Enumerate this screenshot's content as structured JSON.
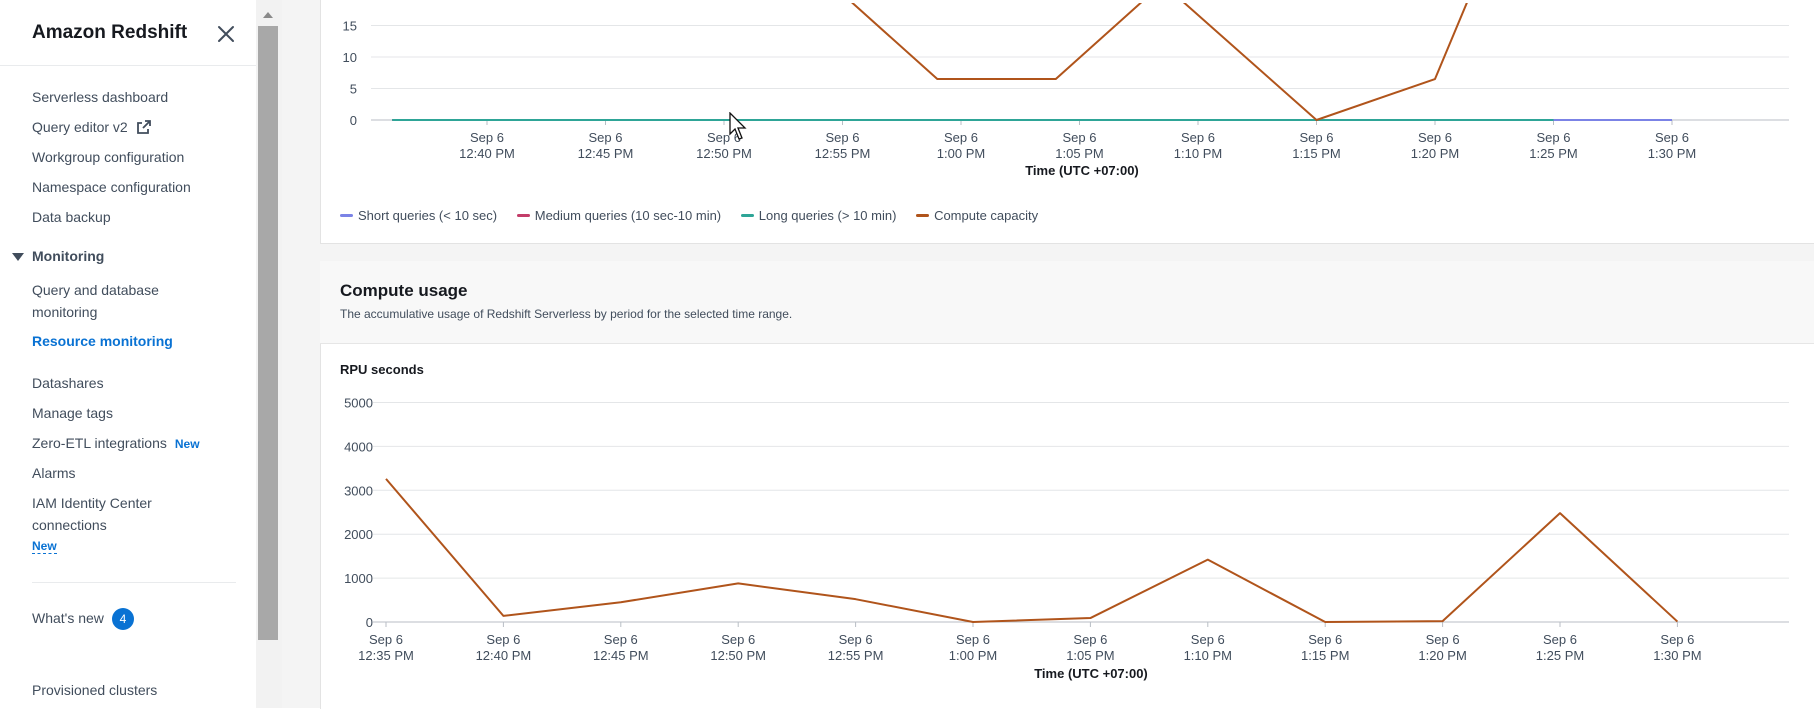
{
  "sidebar": {
    "title": "Amazon Redshift",
    "items": [
      {
        "label": "Serverless dashboard"
      },
      {
        "label": "Query editor v2"
      },
      {
        "label": "Workgroup configuration"
      },
      {
        "label": "Namespace configuration"
      },
      {
        "label": "Data backup"
      }
    ],
    "monitoring": {
      "label": "Monitoring",
      "items": [
        {
          "label": "Query and database monitoring"
        },
        {
          "label": "Resource monitoring"
        }
      ]
    },
    "items2": [
      {
        "label": "Datashares"
      },
      {
        "label": "Manage tags"
      },
      {
        "label": "Zero-ETL integrations",
        "badge": "New"
      },
      {
        "label": "Alarms"
      },
      {
        "label": "IAM Identity Center connections",
        "badge": "New"
      }
    ],
    "whats_new": {
      "label": "What's new",
      "count": "4"
    },
    "provisioned": {
      "label": "Provisioned clusters"
    }
  },
  "icons": {
    "close": "close-icon",
    "external": "external-link-icon",
    "expand": "caret-down-icon"
  },
  "colors": {
    "short": "#7b83e6",
    "medium": "#c33d69",
    "long": "#2ea597",
    "compute": "#b0541b",
    "link": "#0972d3"
  },
  "legend": [
    {
      "label": "Short queries (< 10 sec)",
      "color": "#7b83e6"
    },
    {
      "label": "Medium queries (10 sec-10 min)",
      "color": "#c33d69"
    },
    {
      "label": "Long queries (> 10 min)",
      "color": "#2ea597"
    },
    {
      "label": "Compute capacity",
      "color": "#b0541b"
    }
  ],
  "compute_usage": {
    "title": "Compute usage",
    "description": "The accumulative usage of Redshift Serverless by period for the selected time range.",
    "metric": "RPU seconds"
  },
  "chart_data": [
    {
      "type": "line",
      "xlabel": "Time (UTC +07:00)",
      "ylabel": "",
      "ylim": [
        0,
        15
      ],
      "yticks": [
        0,
        5,
        10,
        15
      ],
      "x_ticks": [
        [
          "Sep 6",
          "12:40 PM"
        ],
        [
          "Sep 6",
          "12:45 PM"
        ],
        [
          "Sep 6",
          "12:50 PM"
        ],
        [
          "Sep 6",
          "12:55 PM"
        ],
        [
          "Sep 6",
          "1:00 PM"
        ],
        [
          "Sep 6",
          "1:05 PM"
        ],
        [
          "Sep 6",
          "1:10 PM"
        ],
        [
          "Sep 6",
          "1:15 PM"
        ],
        [
          "Sep 6",
          "1:20 PM"
        ],
        [
          "Sep 6",
          "1:25 PM"
        ],
        [
          "Sep 6",
          "1:30 PM"
        ]
      ],
      "x_minutes": [
        0,
        5,
        10,
        15,
        20,
        25,
        30,
        35,
        40,
        45,
        50
      ],
      "series": [
        {
          "name": "Short queries (< 10 sec)",
          "x": [
            -4,
            50
          ],
          "values": [
            0,
            0
          ]
        },
        {
          "name": "Medium queries (10 sec-10 min)",
          "x": [
            -4,
            45
          ],
          "values": [
            0,
            0
          ]
        },
        {
          "name": "Long queries (> 10 min)",
          "x": [
            -4,
            45
          ],
          "values": [
            0,
            0
          ]
        },
        {
          "name": "Compute capacity",
          "x": [
            15,
            19,
            24,
            28,
            29,
            35,
            40,
            41.5
          ],
          "values": [
            20,
            6.5,
            6.5,
            20,
            20,
            0,
            6.5,
            20
          ]
        }
      ],
      "legend": "bottom"
    },
    {
      "type": "line",
      "title": "RPU seconds",
      "xlabel": "Time (UTC +07:00)",
      "ylim": [
        0,
        5000
      ],
      "yticks": [
        0,
        1000,
        2000,
        3000,
        4000,
        5000
      ],
      "x_ticks": [
        [
          "Sep 6",
          "12:35 PM"
        ],
        [
          "Sep 6",
          "12:40 PM"
        ],
        [
          "Sep 6",
          "12:45 PM"
        ],
        [
          "Sep 6",
          "12:50 PM"
        ],
        [
          "Sep 6",
          "12:55 PM"
        ],
        [
          "Sep 6",
          "1:00 PM"
        ],
        [
          "Sep 6",
          "1:05 PM"
        ],
        [
          "Sep 6",
          "1:10 PM"
        ],
        [
          "Sep 6",
          "1:15 PM"
        ],
        [
          "Sep 6",
          "1:20 PM"
        ],
        [
          "Sep 6",
          "1:25 PM"
        ],
        [
          "Sep 6",
          "1:30 PM"
        ]
      ],
      "series": [
        {
          "name": "Compute capacity",
          "values": [
            3260,
            140,
            450,
            880,
            520,
            0,
            90,
            1420,
            0,
            20,
            2480,
            10
          ]
        }
      ]
    }
  ]
}
